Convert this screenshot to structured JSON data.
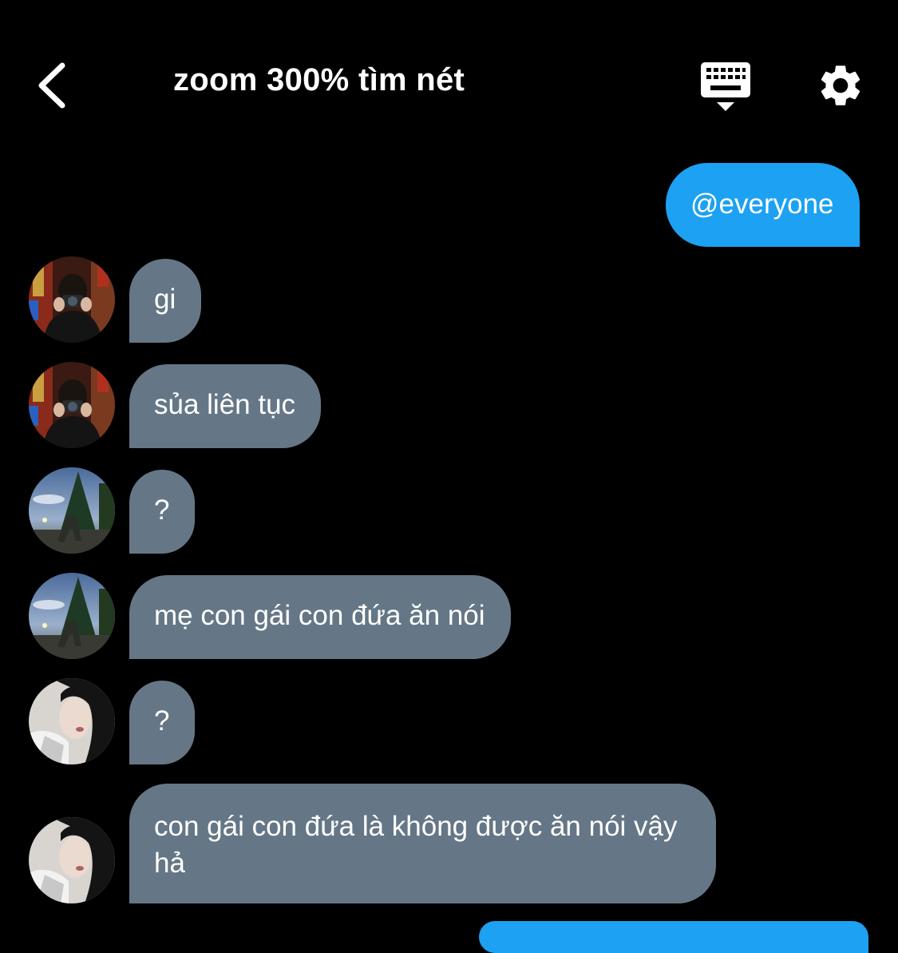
{
  "header": {
    "title": "zoom 300% tìm nét",
    "back_icon": "chevron-left-icon",
    "keyboard_icon": "keyboard-hide-icon",
    "settings_icon": "gear-icon"
  },
  "colors": {
    "background": "#000000",
    "incoming_bubble": "#657786",
    "outgoing_bubble": "#1da1f2",
    "text": "#ffffff"
  },
  "messages": [
    {
      "direction": "outgoing",
      "text": "@everyone"
    },
    {
      "direction": "incoming",
      "sender_avatar": "avatar-camera-person",
      "text": "gi"
    },
    {
      "direction": "incoming",
      "sender_avatar": "avatar-camera-person",
      "text": "sủa liên tục"
    },
    {
      "direction": "incoming",
      "sender_avatar": "avatar-tree-outdoor",
      "text": "?"
    },
    {
      "direction": "incoming",
      "sender_avatar": "avatar-tree-outdoor",
      "text": "mẹ con gái con đứa ăn nói"
    },
    {
      "direction": "incoming",
      "sender_avatar": "avatar-girl-long-hair",
      "text": "?"
    },
    {
      "direction": "incoming",
      "sender_avatar": "avatar-girl-long-hair",
      "text": "con gái con đứa là không được ăn nói vậy hả"
    }
  ]
}
